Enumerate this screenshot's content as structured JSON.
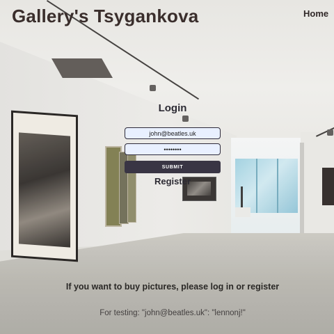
{
  "header": {
    "title": "Gallery's Tsygankova",
    "nav_home": "Home"
  },
  "login": {
    "heading": "Login",
    "email_value": "john@beatles.uk",
    "password_value": "••••••••",
    "submit_label": "SUBMIT",
    "register_label": "Register"
  },
  "footer": {
    "info": "If you want to buy pictures, please log in or register",
    "testing": "For testing: \"john@beatles.uk\": \"lennonj!\""
  },
  "colors": {
    "title": "#3a2e2c",
    "button_bg": "#393544",
    "input_bg": "#e9f0ff"
  }
}
